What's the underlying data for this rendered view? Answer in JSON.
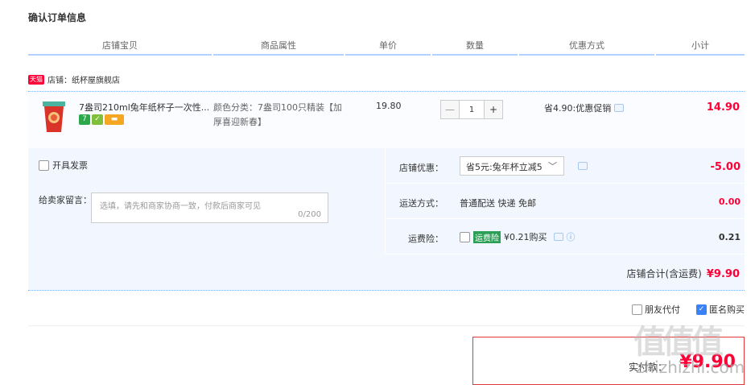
{
  "page_title": "确认订单信息",
  "columns": [
    "店铺宝贝",
    "商品属性",
    "单价",
    "数量",
    "优惠方式",
    "小计"
  ],
  "shop": {
    "badge": "天猫",
    "label": "店铺：纸杯屋旗舰店"
  },
  "item": {
    "name": "7盎司210ml兔年纸杯子一次性...",
    "attr": "颜色分类：7盎司100只精装【加厚喜迎新春】",
    "price": "19.80",
    "quantity": "1",
    "minus": "—",
    "plus": "+",
    "promo": "省4.90:优惠促销",
    "subtotal": "14.90"
  },
  "invoice_label": "开具发票",
  "message": {
    "label": "给卖家留言：",
    "placeholder": "选填，请先和商家协商一致，付款后商家可见",
    "count": "0/200"
  },
  "shop_discount": {
    "label": "店铺优惠：",
    "selected": "省5元:兔年杯立减5",
    "value": "-5.00"
  },
  "shipping": {
    "label": "运送方式：",
    "text": "普通配送 快递 免邮",
    "value": "0.00"
  },
  "insurance": {
    "label": "运费险：",
    "tag": "运费险",
    "text": "¥0.21购买",
    "value": "0.21"
  },
  "shop_total": {
    "label": "店铺合计(含运费)",
    "value": "¥9.90"
  },
  "options": {
    "friend_pay": "朋友代付",
    "anonymous": "匿名购买"
  },
  "pay": {
    "label": "实付款：",
    "amount": "¥9.90"
  },
  "watermark": {
    "big": "值值值",
    "site": "zhizhizhi.com"
  },
  "colors": {
    "accent": "#ff0036",
    "light_blue": "#f2f7ff",
    "border_blue": "#b2d1ff"
  }
}
